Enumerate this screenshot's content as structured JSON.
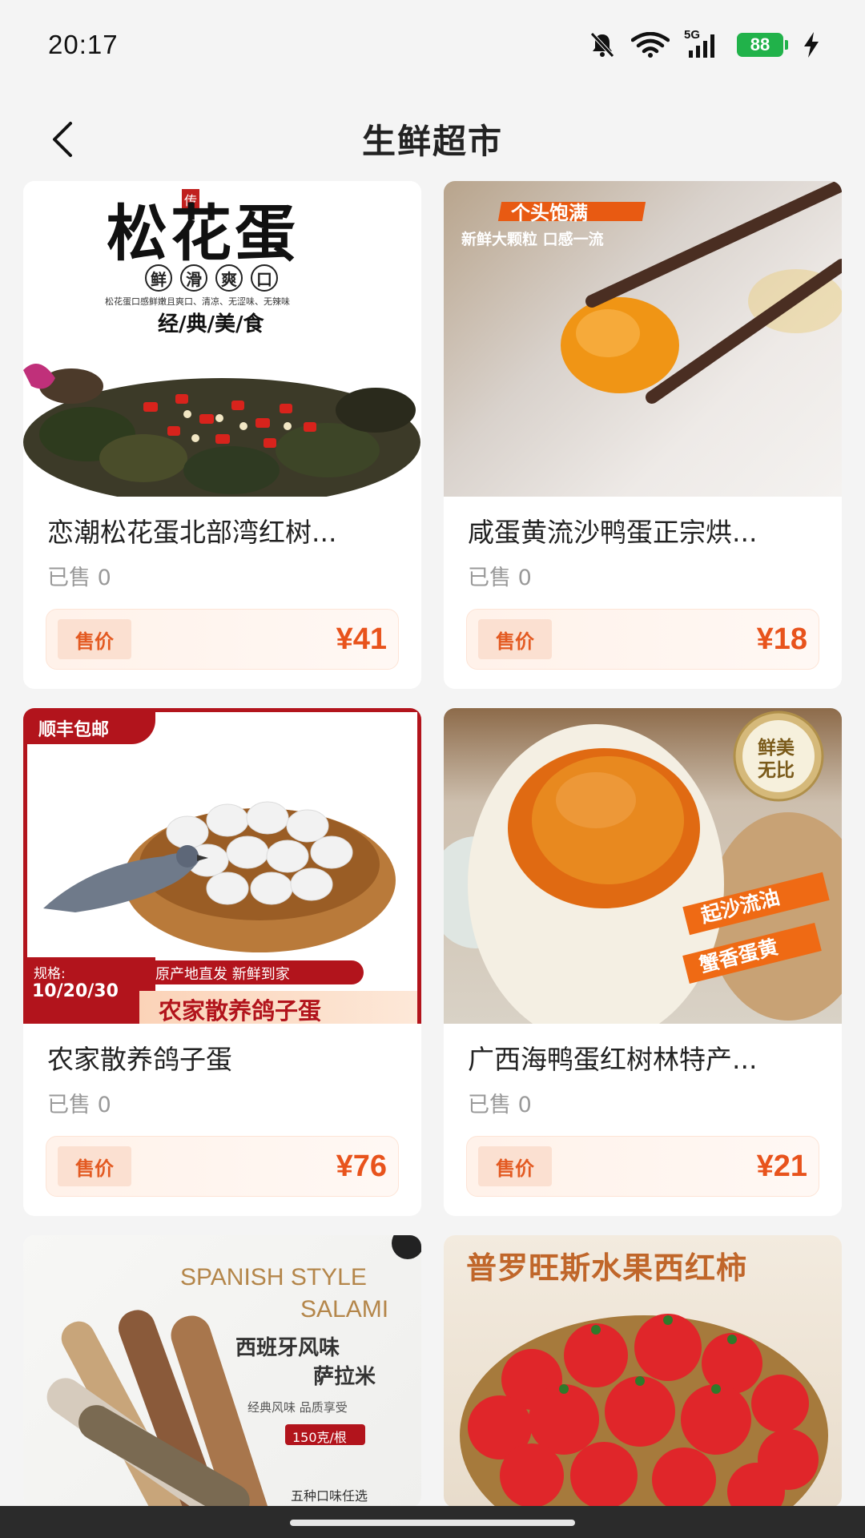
{
  "status_bar": {
    "time": "20:17",
    "network": "5G",
    "battery": "88",
    "icons": [
      "bell-muted-icon",
      "wifi-icon",
      "signal-icon",
      "battery-icon",
      "charging-icon"
    ]
  },
  "header": {
    "title": "生鲜超市",
    "back_icon": "chevron-left-icon"
  },
  "colors": {
    "accent": "#e8531c",
    "price_tag_bg": "#fbe0d1",
    "battery": "#21b24a"
  },
  "products": [
    {
      "name": "恋潮松花蛋北部湾红树...",
      "sold": "已售 0",
      "price_label": "售价",
      "price": "¥41",
      "image_texts": {
        "title": "松花蛋",
        "stamp": "传",
        "badges": [
          "鲜",
          "滑",
          "爽",
          "口"
        ],
        "desc": "松花蛋口感鲜嫩且爽口、清凉、无涩味、无辣味",
        "slogan": "经/典/美/食"
      }
    },
    {
      "name": "咸蛋黄流沙鸭蛋正宗烘...",
      "sold": "已售 0",
      "price_label": "售价",
      "price": "¥18",
      "image_texts": {
        "banner": "个头饱满",
        "line": "新鲜大颗粒  口感一流"
      }
    },
    {
      "name": "农家散养鸽子蛋",
      "sold": "已售 0",
      "price_label": "售价",
      "price": "¥76",
      "image_texts": {
        "corner": "顺丰包邮",
        "spec_label": "规格:",
        "spec_value": "10/20/30",
        "ribbon": "原产地直发  新鲜到家",
        "title": "农家散养鸽子蛋"
      }
    },
    {
      "name": "广西海鸭蛋红树林特产...",
      "sold": "已售 0",
      "price_label": "售价",
      "price": "¥21",
      "image_texts": {
        "seal_line1": "鲜美",
        "seal_line2": "无比",
        "banner1": "起沙流油",
        "banner2": "蟹香蛋黄"
      }
    },
    {
      "image_texts": {
        "title_en_1": "SPANISH STYLE",
        "title_en_2": "SALAMI",
        "title_cn_1": "西班牙风味",
        "title_cn_2": "萨拉米",
        "sub": "经典风味 品质享受",
        "tag": "150克/根",
        "bottom": "五种口味任选"
      }
    },
    {
      "image_texts": {
        "title": "普罗旺斯水果西红柿"
      }
    }
  ]
}
